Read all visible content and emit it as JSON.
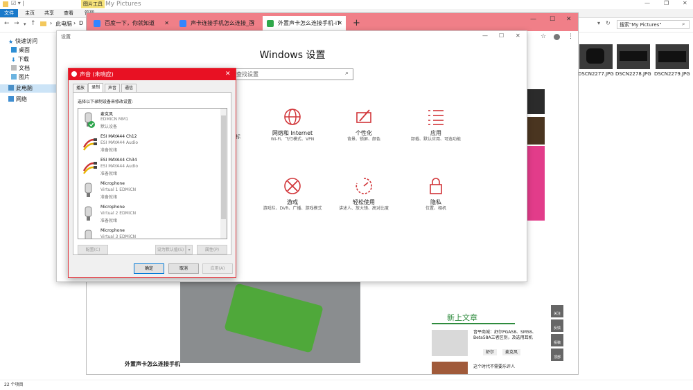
{
  "explorer": {
    "title": "My Pictures",
    "ribbon_tabs": [
      "文件",
      "主页",
      "共享",
      "查看",
      "管理"
    ],
    "picture_tools_label": "图片工具",
    "address_root": "此电脑",
    "address_tail": "D",
    "search_placeholder": "搜索\"My Pictures\"",
    "nav": {
      "quick_access": "快速访问",
      "desktop": "桌面",
      "downloads": "下载",
      "documents": "文档",
      "pictures": "图片",
      "this_pc": "此电脑",
      "network": "网络"
    },
    "status": "22 个项目",
    "files": [
      "DSCN2277.JPG",
      "DSCN2278.JPG",
      "DSCN2279.JPG"
    ]
  },
  "browser": {
    "tabs": [
      {
        "label": "百度一下，你就知道",
        "favicon_color": "#3385ff"
      },
      {
        "label": "声卡连接手机怎么连接_百",
        "favicon_color": "#3385ff"
      },
      {
        "label": "外置声卡怎么连接手机-iT",
        "favicon_color": "#2ea84a"
      }
    ],
    "new_tab": "+",
    "webpage": {
      "caption": "外置声卡怎么连接手机",
      "new_articles_heading": "新上文章",
      "articles": [
        {
          "text": "音平商城：舒尔PGA58、SM58、Beta58A三者区别，及选用耳机",
          "tags": [
            "舒尔",
            "麦克风"
          ]
        },
        {
          "text": "这个时代不需要乐评人",
          "tags": []
        }
      ],
      "side_buttons": [
        "关注",
        "反馈",
        "投稿",
        "顶部"
      ]
    }
  },
  "settings": {
    "window_title": "设置",
    "heading": "Windows 设置",
    "search_placeholder": "查找设置",
    "categories": [
      {
        "title": "网络和 Internet",
        "desc": "Wi-Fi、飞行模式、VPN",
        "icon": "globe-icon"
      },
      {
        "title": "个性化",
        "desc": "背景、锁屏、颜色",
        "icon": "personalization-icon"
      },
      {
        "title": "应用",
        "desc": "卸载、默认应用、可选功能",
        "icon": "apps-icon"
      },
      {
        "title": "游戏",
        "desc": "游戏栏、DVR、广播、游戏模式",
        "icon": "xbox-icon"
      },
      {
        "title": "轻松使用",
        "desc": "讲述人、放大镜、高对比度",
        "icon": "ease-of-access-icon"
      },
      {
        "title": "隐私",
        "desc": "位置、相机",
        "icon": "lock-icon"
      }
    ],
    "partial_left": "标"
  },
  "sound_dialog": {
    "title": "声音 (未响应)",
    "tabs": [
      "播放",
      "录制",
      "声音",
      "通信"
    ],
    "active_tab": "录制",
    "instruction": "选择以下录制设备来修改设置:",
    "devices": [
      {
        "name": "麦克风",
        "driver": "EDMiCN MM1",
        "status": "默认设备",
        "kind": "mic",
        "default": true
      },
      {
        "name": "ESI MAYA44 Ch12",
        "driver": "ESI MAYA44 Audio",
        "status": "准备就绪",
        "kind": "cable",
        "default": false
      },
      {
        "name": "ESI MAYA44 Ch34",
        "driver": "ESI MAYA44 Audio",
        "status": "准备就绪",
        "kind": "cable",
        "default": false
      },
      {
        "name": "Microphone",
        "driver": "Virtual 1 EDMiCN",
        "status": "准备就绪",
        "kind": "mic",
        "default": false
      },
      {
        "name": "Microphone",
        "driver": "Virtual 2 EDMiCN",
        "status": "准备就绪",
        "kind": "mic",
        "default": false
      },
      {
        "name": "Microphone",
        "driver": "Virtual 3 EDMiCN",
        "status": "",
        "kind": "mic",
        "default": false
      }
    ],
    "configure_button": "配置(C)",
    "set_default_button": "设为默认值(S)",
    "properties_button": "属性(P)",
    "ok_button": "确定",
    "cancel_button": "取消",
    "apply_button": "应用(A)"
  },
  "colors": {
    "accent_red": "#e81123",
    "settings_icon_red": "#d13438",
    "browser_tabbar": "#f07f88",
    "green_heading": "#2e8b3d"
  }
}
